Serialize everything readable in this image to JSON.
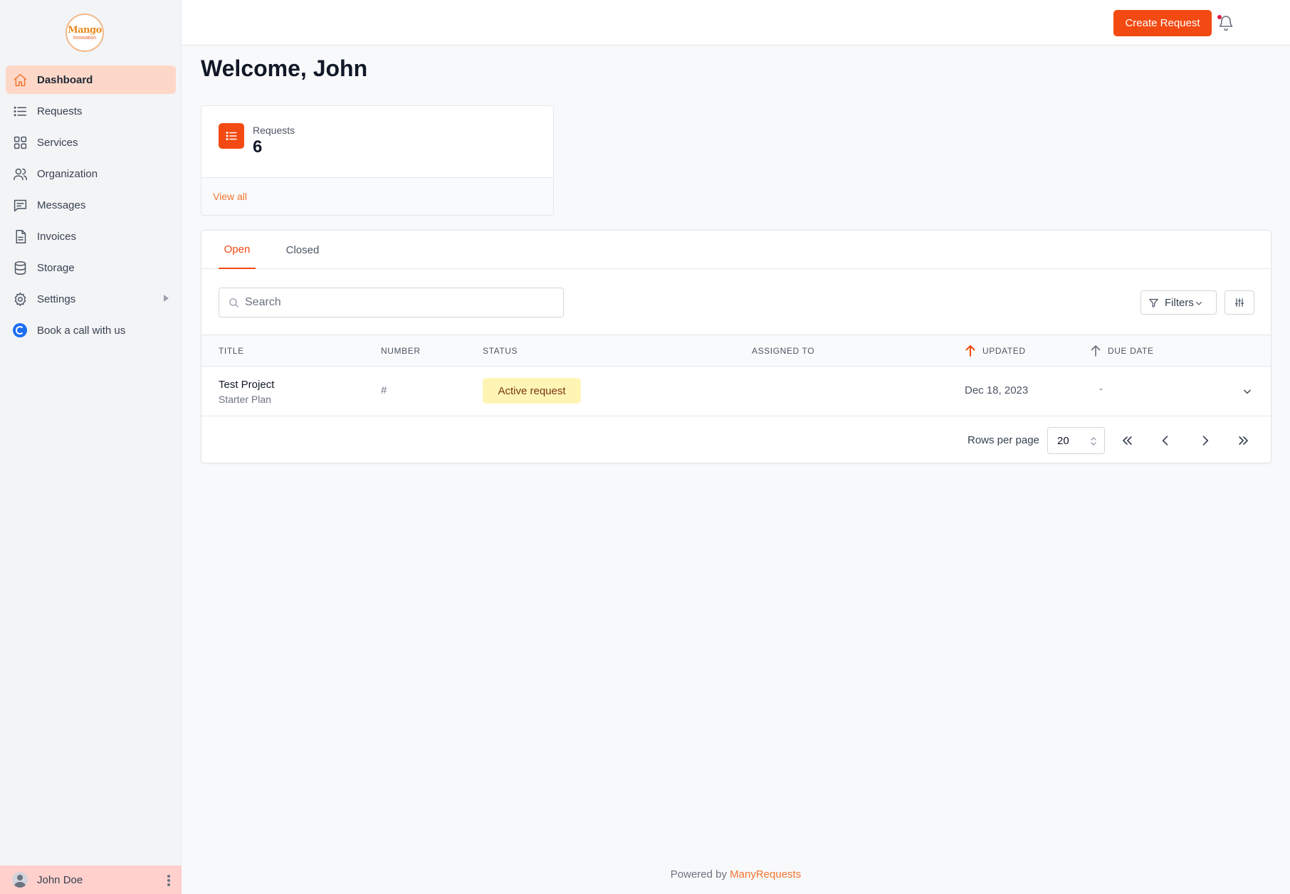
{
  "brand": {
    "logo_line1": "Mango",
    "logo_line2": "Innovation"
  },
  "sidebar": {
    "items": [
      {
        "label": "Dashboard",
        "icon": "home-icon",
        "active": true
      },
      {
        "label": "Requests",
        "icon": "list-icon"
      },
      {
        "label": "Services",
        "icon": "grid-icon"
      },
      {
        "label": "Organization",
        "icon": "users-icon"
      },
      {
        "label": "Messages",
        "icon": "chat-icon"
      },
      {
        "label": "Invoices",
        "icon": "document-icon"
      },
      {
        "label": "Storage",
        "icon": "database-icon"
      },
      {
        "label": "Settings",
        "icon": "gear-icon",
        "has_submenu": true
      },
      {
        "label": "Book a call with us",
        "icon": "calendly-icon"
      }
    ],
    "user": {
      "name": "John Doe"
    }
  },
  "header": {
    "create_label": "Create Request"
  },
  "main": {
    "welcome": "Welcome, John",
    "stat": {
      "label": "Requests",
      "value": "6",
      "link": "View all"
    },
    "tabs": [
      {
        "label": "Open",
        "active": true
      },
      {
        "label": "Closed"
      }
    ],
    "search": {
      "placeholder": "Search"
    },
    "filters_label": "Filters",
    "table": {
      "columns": [
        "TITLE",
        "NUMBER",
        "STATUS",
        "ASSIGNED TO",
        "UPDATED",
        "DUE DATE"
      ],
      "rows": [
        {
          "title": "Test Project",
          "subtitle": "Starter Plan",
          "number": "#",
          "status": "Active request",
          "assigned": "",
          "updated": "Dec 18, 2023",
          "due": "-"
        }
      ]
    },
    "pagination": {
      "rows_label": "Rows per page",
      "rows_value": "20"
    }
  },
  "footer": {
    "prefix": "Powered by",
    "brand": "ManyRequests"
  },
  "colors": {
    "accent": "#f24a12",
    "active_bg": "#fdd8c8",
    "badge_bg": "#fef5b5"
  }
}
